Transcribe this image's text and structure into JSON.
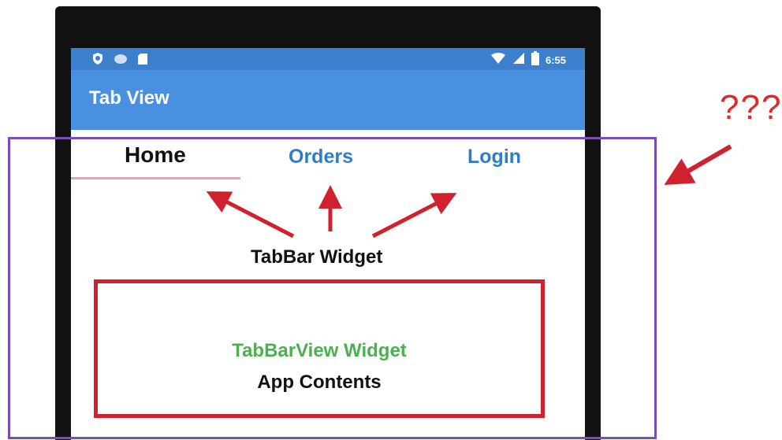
{
  "status_bar": {
    "time": "6:55",
    "left_icons": [
      "shield-icon",
      "cloud-icon",
      "sd-card-icon"
    ],
    "right_icons": [
      "wifi-icon",
      "signal-icon",
      "battery-icon"
    ]
  },
  "app_bar": {
    "title": "Tab View"
  },
  "tabs": [
    {
      "label": "Home",
      "selected": true
    },
    {
      "label": "Orders",
      "selected": false
    },
    {
      "label": "Login",
      "selected": false
    }
  ],
  "annotations": {
    "tabbar_label": "TabBar Widget",
    "tabbarview_label": "TabBarView Widget",
    "app_contents_label": "App Contents",
    "question": "???"
  },
  "colors": {
    "status_bar": "#3b7fcd",
    "app_bar": "#4a90e0",
    "tab_text_inactive": "#2f7dc4",
    "indicator": "#f0a0a0",
    "arrow_red": "#d0212e",
    "frame_purple": "#7b4bb8",
    "tabbarview_green": "#4caf50"
  }
}
